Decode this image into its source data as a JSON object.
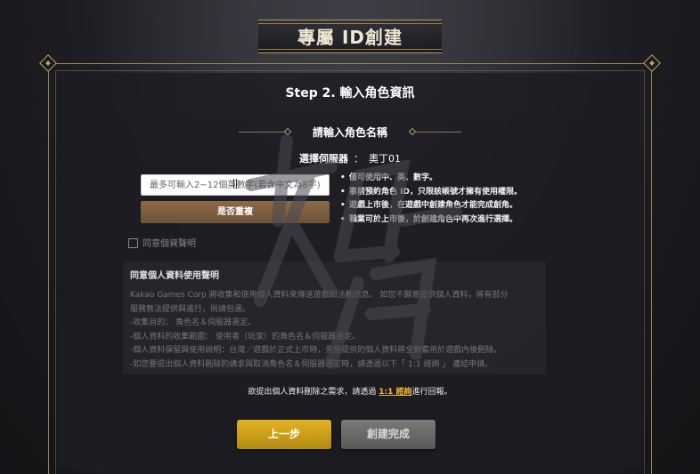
{
  "header": {
    "title": "專屬 ID創建"
  },
  "step": {
    "title": "Step 2. 輸入角色資訊"
  },
  "section": {
    "title": "請輸入角色名稱"
  },
  "server": {
    "label": "選擇伺服器",
    "colon": "：",
    "value": "奧丁01"
  },
  "name_input": {
    "placeholder": "最多可輸入2~12個英數字(若含中文為8字)",
    "value": ""
  },
  "check_button": {
    "label": "是否重複"
  },
  "rules": [
    "僅可使用中、英、數字。",
    "事前預約角色 ID，只限該帳號才擁有使用權限。",
    "遊戲上市後，在遊戲中創建角色才能完成創角。",
    "職業可於上市後，於創建角色中再次進行選擇。"
  ],
  "agree": {
    "label": "同意個資聲明",
    "checked": false
  },
  "privacy": {
    "title": "同意個人資料使用聲明",
    "lines": [
      "Kakao Games Corp 將收集和使用個人資料來傳送遊戲和活動訊息。 如您不願意提供個人資料，將有部分",
      "服務無法提供與進行，尚請包涵。",
      "-收集目的： 角色名＆伺服器選定。",
      "-個人資料的收集範圍： 使用者（玩家）的角色名＆伺服器選定。",
      "-個人資料保留與使用說明：台灣／遊戲於正式上市時，先前提供的個人資料將全數套用於遊戲內後刪除。",
      "-如您要提出個人資料刪除的請求與取消角色名＆伺服器選定時，請透過以下「 1:1 諮詢 」 連結申請。"
    ]
  },
  "deletion_note": {
    "prefix": "欲提出個人資料刪除之需求，請透過 ",
    "link": "1:1 諮詢",
    "suffix": "進行回報。"
  },
  "buttons": {
    "prev": "上一步",
    "done": "創建完成"
  },
  "colors": {
    "gold": "#e2b422",
    "frame": "#9b8256",
    "link": "#f0b73a",
    "brown_button": "#7d5e3f"
  }
}
